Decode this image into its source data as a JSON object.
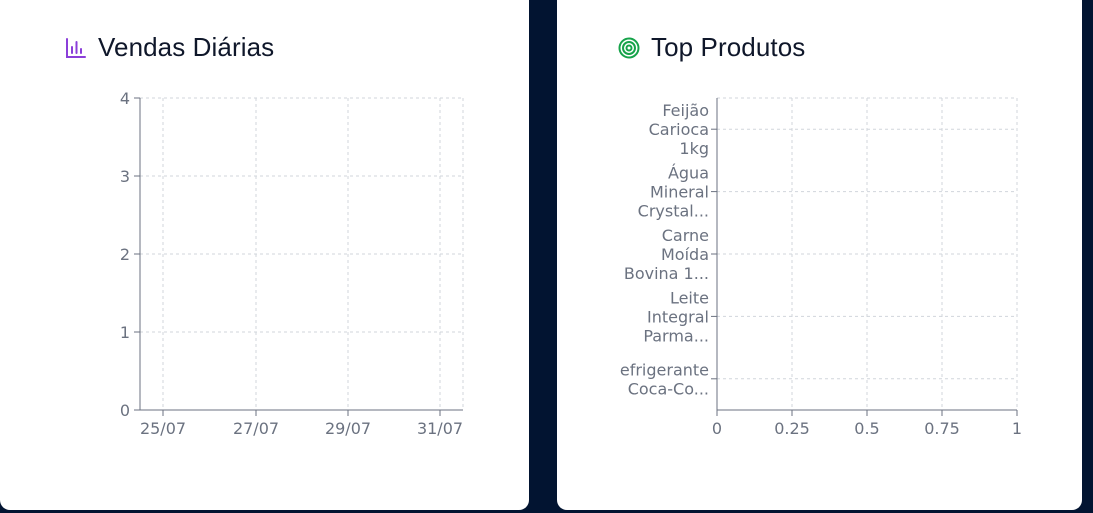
{
  "cards": [
    {
      "title": "Vendas Diárias",
      "icon": "bar-chart-icon",
      "icon_color": "#8b3fd9"
    },
    {
      "title": "Top Produtos",
      "icon": "target-icon",
      "icon_color": "#16a34a"
    }
  ],
  "colors": {
    "background": "#021431",
    "card": "#ffffff",
    "grid": "#d1d5db",
    "axis": "#6b7280"
  },
  "chart_data": [
    {
      "type": "bar",
      "title": "Vendas Diárias",
      "x_ticks": [
        "25/07",
        "27/07",
        "29/07",
        "31/07"
      ],
      "y_ticks": [
        0,
        1,
        2,
        3,
        4
      ],
      "ylim": [
        0,
        4
      ],
      "grid": true,
      "series": []
    },
    {
      "type": "bar",
      "orientation": "horizontal",
      "title": "Top Produtos",
      "categories": [
        [
          "Feijão",
          "Carioca",
          "1kg"
        ],
        [
          "Água",
          "Mineral",
          "Crystal..."
        ],
        [
          "Carne",
          "Moída",
          "Bovina 1..."
        ],
        [
          "Leite",
          "Integral",
          "Parma..."
        ],
        [
          "efrigerante",
          "Coca-Co..."
        ]
      ],
      "x_ticks": [
        "0",
        "0.25",
        "0.5",
        "0.75",
        "1"
      ],
      "xlim": [
        0,
        1
      ],
      "grid": true,
      "series": []
    }
  ]
}
